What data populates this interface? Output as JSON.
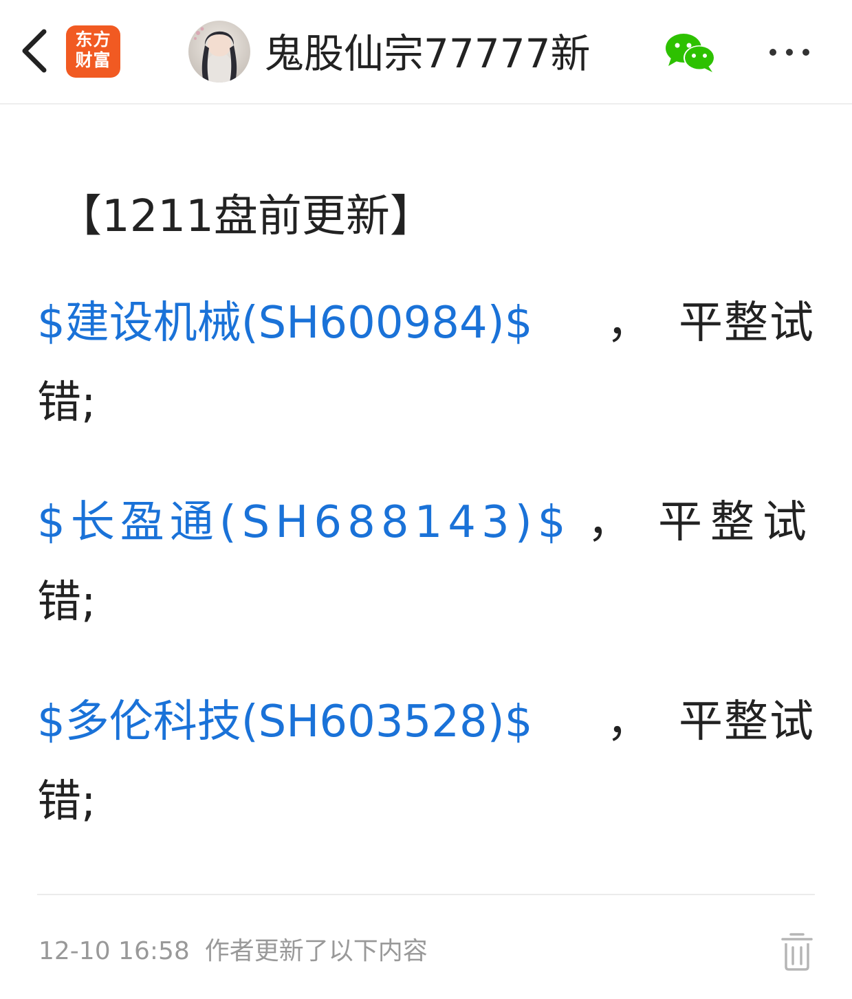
{
  "header": {
    "back_icon": "chevron-left-icon",
    "logo_line1": "东方",
    "logo_line2": "财富",
    "logo_color": "#f15a22",
    "author_name": "鬼股仙宗77777新",
    "share_icon": "wechat-icon",
    "more_icon": "more-dots-icon"
  },
  "post": {
    "title": "【1211盘前更新】",
    "stocks": [
      {
        "link": "$建设机械(SH600984)$",
        "comma": "，",
        "suffix": "平整试",
        "tail": "错;"
      },
      {
        "link": "$长盈通(SH688143)$",
        "comma": "，",
        "suffix": "平整试",
        "tail": "错;"
      },
      {
        "link": "$多伦科技(SH603528)$",
        "comma": "，",
        "suffix": "平整试",
        "tail": "错;"
      }
    ]
  },
  "footer": {
    "timestamp": "12-10 16:58",
    "update_note": "作者更新了以下内容",
    "delete_icon": "trash-icon"
  },
  "colors": {
    "link": "#1a72d8",
    "wechat": "#2dc100",
    "meta": "#999999"
  }
}
